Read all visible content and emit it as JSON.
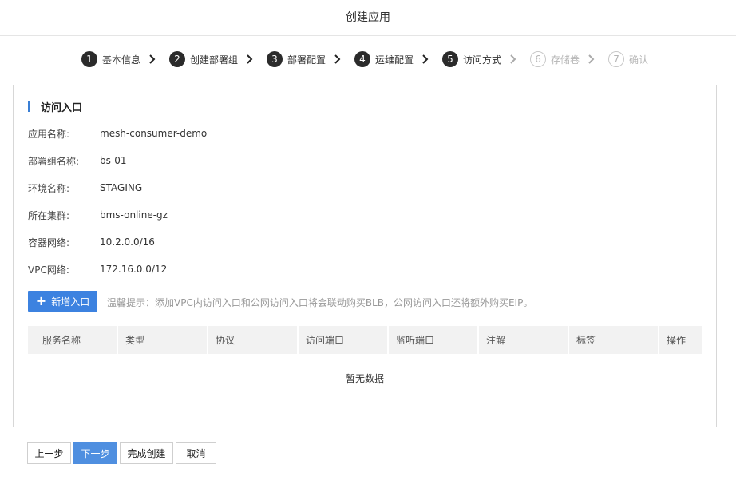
{
  "header": {
    "title": "创建应用"
  },
  "steps": [
    {
      "num": "1",
      "label": "基本信息",
      "state": "done"
    },
    {
      "num": "2",
      "label": "创建部署组",
      "state": "done"
    },
    {
      "num": "3",
      "label": "部署配置",
      "state": "done"
    },
    {
      "num": "4",
      "label": "运维配置",
      "state": "done"
    },
    {
      "num": "5",
      "label": "访问方式",
      "state": "current"
    },
    {
      "num": "6",
      "label": "存储卷",
      "state": "inactive"
    },
    {
      "num": "7",
      "label": "确认",
      "state": "inactive"
    }
  ],
  "section": {
    "title": "访问入口"
  },
  "info": [
    {
      "key": "应用名称:",
      "value": "mesh-consumer-demo"
    },
    {
      "key": "部署组名称:",
      "value": "bs-01"
    },
    {
      "key": "环境名称:",
      "value": "STAGING"
    },
    {
      "key": "所在集群:",
      "value": "bms-online-gz"
    },
    {
      "key": "容器网络:",
      "value": "10.2.0.0/16"
    },
    {
      "key": "VPC网络:",
      "value": "172.16.0.0/12"
    }
  ],
  "add_button": {
    "label": "新增入口",
    "icon": "plus-icon"
  },
  "hint": "温馨提示：添加VPC内访问入口和公网访问入口将会联动购买BLB，公网访问入口还将额外购买EIP。",
  "table": {
    "columns": [
      "服务名称",
      "类型",
      "协议",
      "访问端口",
      "监听端口",
      "注解",
      "标签",
      "操作"
    ],
    "empty_text": "暂无数据"
  },
  "footer": {
    "prev": "上一步",
    "next": "下一步",
    "finish": "完成创建",
    "cancel": "取消"
  },
  "colors": {
    "accent": "#3c82e0",
    "step_active": "#2b2b2b",
    "muted": "#b5b5b5"
  }
}
